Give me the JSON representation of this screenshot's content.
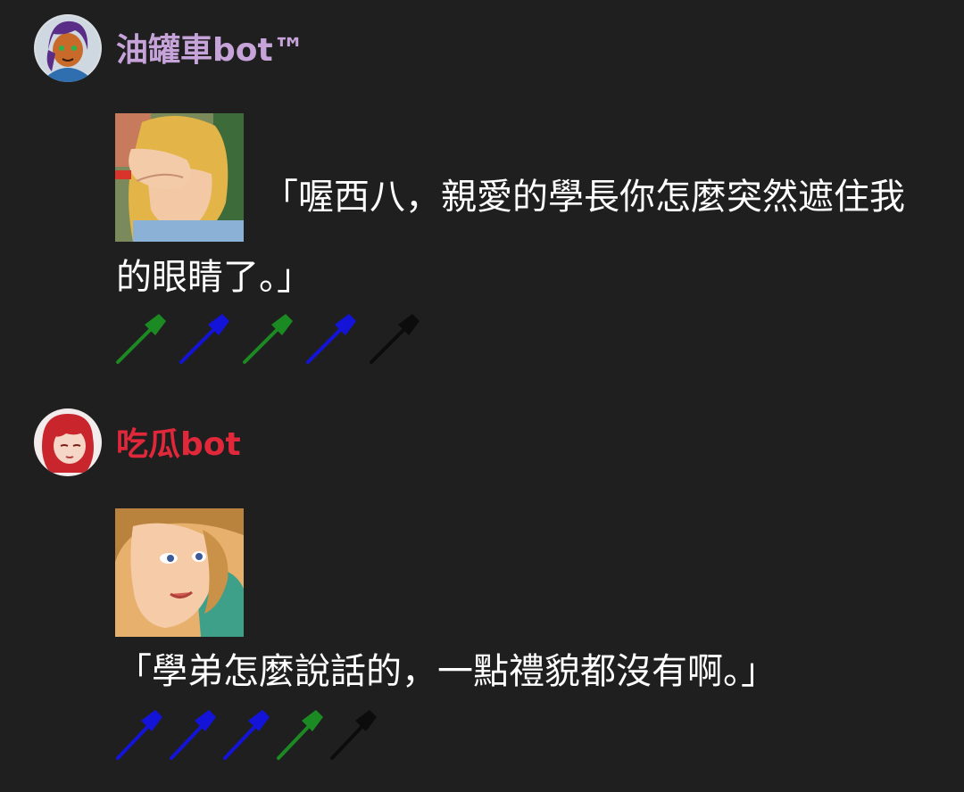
{
  "messages": [
    {
      "username": "油罐車bot™",
      "name_color": "#c6a3d8",
      "avatar_icon": "purple-haired-character-avatar",
      "thumbnail_icon": "blonde-girl-covering-eyes-thumbnail",
      "text": "「喔西八，親愛的學長你怎麼突然遮住我的眼睛了。」",
      "reactions": [
        "green",
        "blue",
        "green",
        "blue",
        "black"
      ]
    },
    {
      "username": "吃瓜bot",
      "name_color": "#e0283a",
      "avatar_icon": "red-haired-character-avatar",
      "thumbnail_icon": "smiling-blonde-woman-thumbnail",
      "text": "「學弟怎麼說話的，一點禮貌都沒有啊。」",
      "reactions": [
        "blue",
        "blue",
        "blue",
        "green",
        "black"
      ]
    }
  ],
  "colors": {
    "background": "#1f1f20",
    "text": "#ffffff",
    "reaction_green": "#1c8a22",
    "reaction_blue": "#1414d8",
    "reaction_black": "#0c0c0c"
  }
}
